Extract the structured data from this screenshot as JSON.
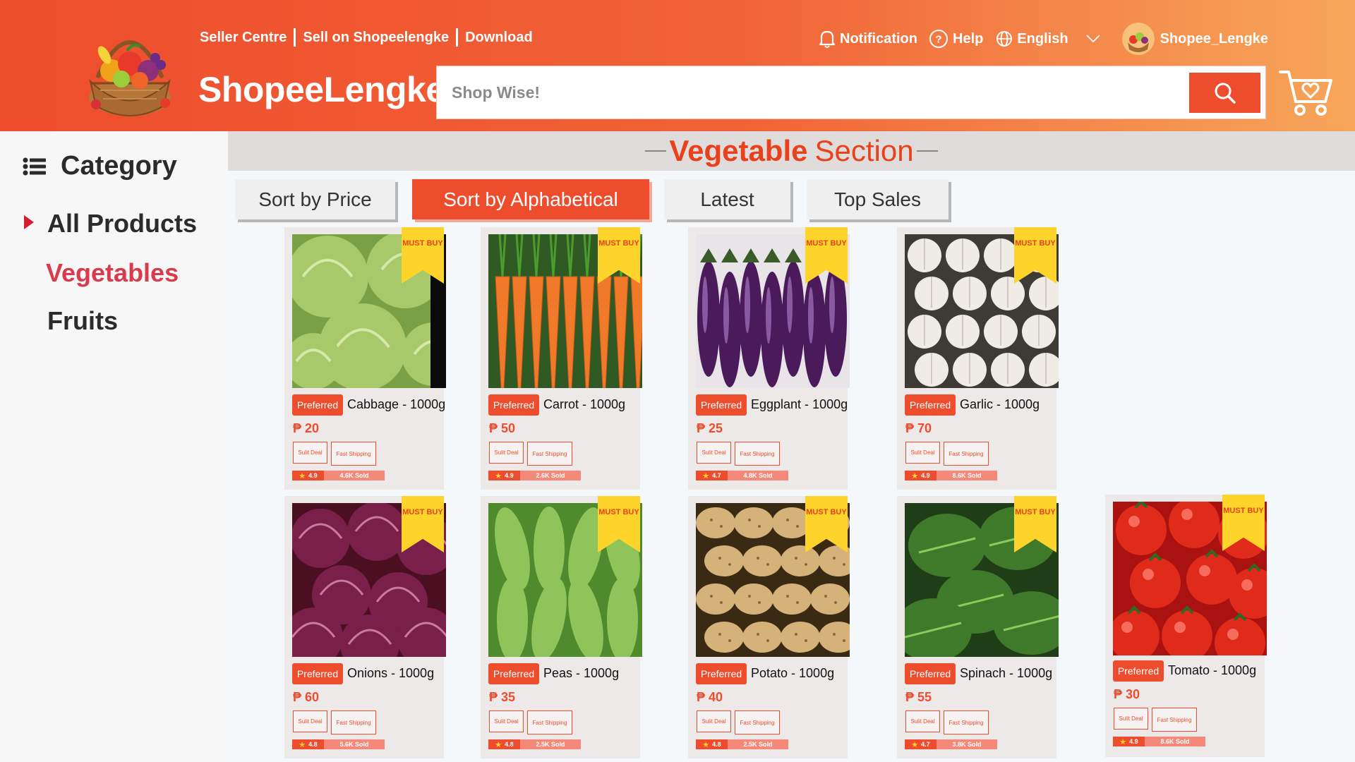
{
  "header": {
    "links": [
      "Seller Centre",
      "Sell on Shopeelengke",
      "Download"
    ],
    "brand": "ShopeeLengke",
    "search_placeholder": "Shop Wise!",
    "nav": {
      "notification": "Notification",
      "help": "Help",
      "language": "English",
      "username": "Shopee_Lengke"
    }
  },
  "sidebar": {
    "title": "Category",
    "items": [
      "All Products",
      "Vegetables",
      "Fruits"
    ],
    "active": "Vegetables"
  },
  "section": {
    "title_bold": "Vegetable",
    "title_light": "Section"
  },
  "sort_buttons": [
    "Sort by Price",
    "Sort by Alphabetical",
    "Latest",
    "Top Sales"
  ],
  "active_sort": "Sort by Alphabetical",
  "labels": {
    "must_buy": "MUST BUY",
    "preferred": "Preferred",
    "suli_deal": "Sulit Deal",
    "fast_shipping": "Fast Shipping",
    "sold": "Sold"
  },
  "colors": {
    "brand": "#ee4d2d",
    "ribbon": "#ffd42a",
    "active_category": "#d93a4c"
  },
  "products": [
    {
      "name": "Cabbage - 1000g",
      "price": "₱ 20",
      "rating": "4.9",
      "sold": "4.6K",
      "image": "cabbage"
    },
    {
      "name": "Carrot - 1000g",
      "price": "₱ 50",
      "rating": "4.9",
      "sold": "2.6K",
      "image": "carrot"
    },
    {
      "name": "Eggplant - 1000g",
      "price": "₱ 25",
      "rating": "4.7",
      "sold": "4.8K",
      "image": "eggplant"
    },
    {
      "name": "Garlic - 1000g",
      "price": "₱ 70",
      "rating": "4.9",
      "sold": "8.6K",
      "image": "garlic"
    },
    {
      "name": "Onions - 1000g",
      "price": "₱ 60",
      "rating": "4.8",
      "sold": "5.6K",
      "image": "onion"
    },
    {
      "name": "Peas - 1000g",
      "price": "₱ 35",
      "rating": "4.8",
      "sold": "2.5K",
      "image": "peas"
    },
    {
      "name": "Potato - 1000g",
      "price": "₱ 40",
      "rating": "4.8",
      "sold": "2.5K",
      "image": "potato"
    },
    {
      "name": "Spinach - 1000g",
      "price": "₱ 55",
      "rating": "4.7",
      "sold": "3.8K",
      "image": "spinach"
    },
    {
      "name": "Tomato - 1000g",
      "price": "₱ 30",
      "rating": "4.9",
      "sold": "8.6K",
      "image": "tomato"
    }
  ]
}
